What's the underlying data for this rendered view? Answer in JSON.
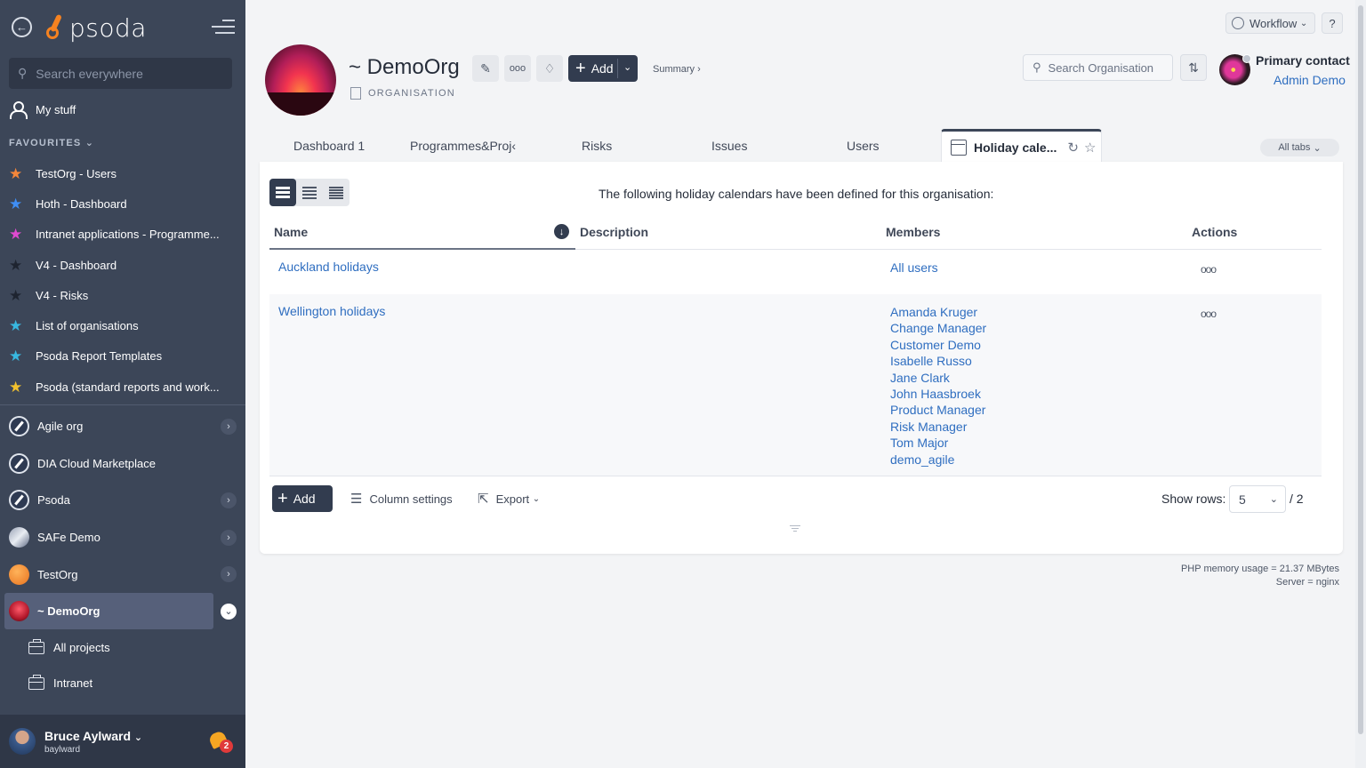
{
  "sidebar": {
    "logo_text": "psoda",
    "search_placeholder": "Search everywhere",
    "my_stuff": "My stuff",
    "favourites_label": "FAVOURITES",
    "favourites": [
      {
        "label": "TestOrg - Users",
        "color": "#f5873a"
      },
      {
        "label": "Hoth - Dashboard",
        "color": "#3f8ef5"
      },
      {
        "label": "Intranet applications - Programme...",
        "color": "#e04ad0"
      },
      {
        "label": "V4 - Dashboard",
        "color": "#1e2430"
      },
      {
        "label": "V4 - Risks",
        "color": "#1e2430"
      },
      {
        "label": "List of organisations",
        "color": "#38b8e0"
      },
      {
        "label": "Psoda Report Templates",
        "color": "#38b8e0"
      },
      {
        "label": "Psoda (standard reports and work...",
        "color": "#f2c12e"
      }
    ],
    "orgs": [
      {
        "label": "Agile org"
      },
      {
        "label": "DIA Cloud Marketplace"
      },
      {
        "label": "Psoda"
      },
      {
        "label": "SAFe Demo"
      },
      {
        "label": "TestOrg"
      },
      {
        "label": "~ DemoOrg"
      }
    ],
    "sub_items": [
      {
        "label": "All projects"
      },
      {
        "label": "Intranet"
      }
    ],
    "user": {
      "name": "Bruce Aylward",
      "handle": "baylward",
      "notifications": "2"
    }
  },
  "topbar": {
    "workflow_label": "Workflow",
    "help_label": "?"
  },
  "header": {
    "title": "~ DemoOrg",
    "type_label": "ORGANISATION",
    "add_label": "Add",
    "summary_link": "Summary ›",
    "search_placeholder": "Search Organisation",
    "primary_contact_label": "Primary contact",
    "primary_contact_name": "Admin Demo"
  },
  "tabs": {
    "items": [
      {
        "label": "Dashboard 1"
      },
      {
        "label": "Programmes&Proj‹"
      },
      {
        "label": "Risks"
      },
      {
        "label": "Issues"
      },
      {
        "label": "Users"
      }
    ],
    "active_label": "Holiday cale...",
    "all_tabs_label": "All tabs"
  },
  "table": {
    "intro": "The following holiday calendars have been defined for this organisation:",
    "columns": {
      "name": "Name",
      "description": "Description",
      "members": "Members",
      "actions": "Actions"
    },
    "rows": [
      {
        "name": "Auckland holidays",
        "description": "",
        "members": [
          "All users"
        ],
        "actions": "ooo"
      },
      {
        "name": "Wellington holidays",
        "description": "",
        "members": [
          "Amanda Kruger",
          "Change Manager",
          "Customer Demo",
          "Isabelle Russo",
          "Jane Clark",
          "John Haasbroek",
          "Product Manager",
          "Risk Manager",
          "Tom Major",
          "demo_agile"
        ],
        "actions": "ooo"
      }
    ],
    "add_label": "Add",
    "column_settings_label": "Column settings",
    "export_label": "Export",
    "show_rows_label": "Show rows:",
    "rows_value": "5",
    "rows_total": "/ 2"
  },
  "footer": {
    "memory": "PHP memory usage = 21.37 MBytes",
    "server": "Server = nginx"
  }
}
